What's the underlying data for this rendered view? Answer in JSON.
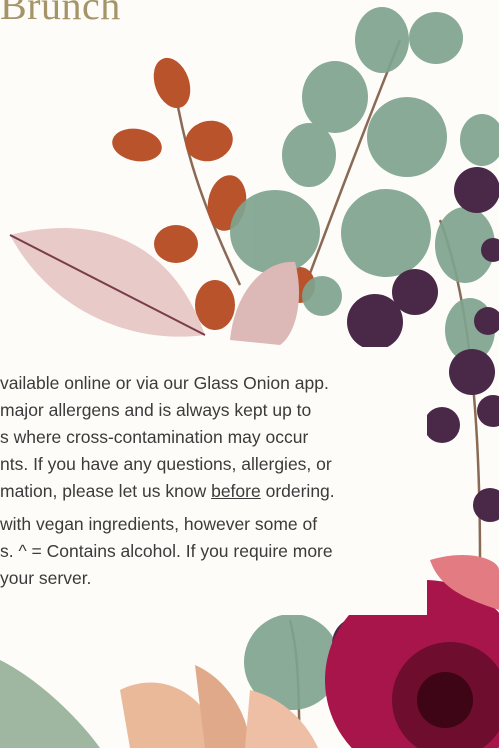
{
  "menu": {
    "title_fragment": "Brunch"
  },
  "info": {
    "paragraph1": {
      "line1": "vailable online or via our Glass Onion app.",
      "line2": " major allergens and is always kept up to",
      "line3": "s where cross-contamination may occur",
      "line4": "nts. If you have any questions, allergies, or",
      "line5_start": "mation, please let us know ",
      "line5_emphasis": "before",
      "line5_end": " ordering."
    },
    "paragraph2": {
      "line1": "with vegan ingredients, however some of",
      "line2": "s. ^ = Contains alcohol. If you require more",
      "line3": " your server."
    }
  },
  "colors": {
    "background": "#fdfcf8",
    "title": "#a59468",
    "text": "#3b3b3b"
  }
}
